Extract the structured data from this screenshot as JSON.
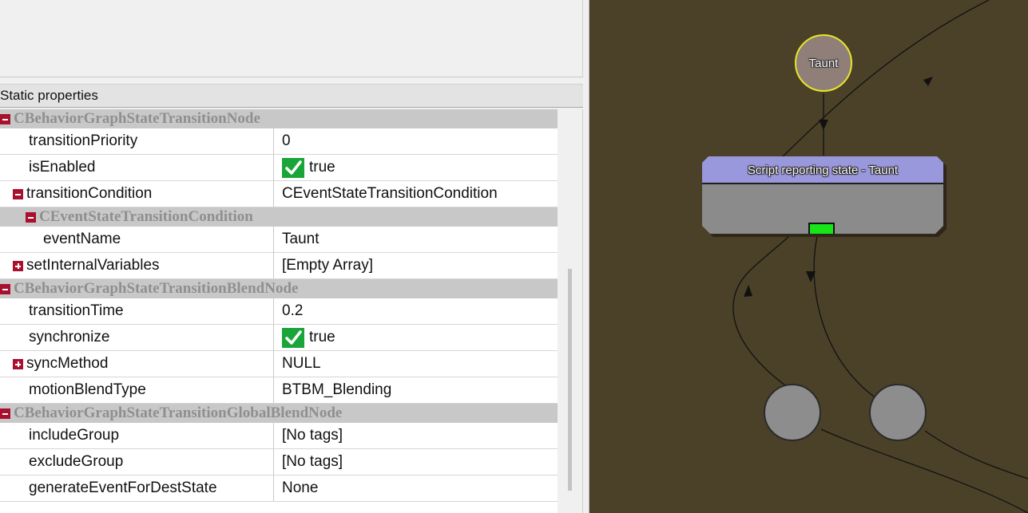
{
  "properties_panel": {
    "header": "Static properties",
    "rows": [
      {
        "kind": "category",
        "label": "CBehaviorGraphStateTransitionNode",
        "toggle": "minus",
        "indent": 0
      },
      {
        "kind": "prop",
        "name": "transitionPriority",
        "value": "0"
      },
      {
        "kind": "prop",
        "name": "isEnabled",
        "value": "true",
        "checkbox": true
      },
      {
        "kind": "prop",
        "name": "transitionCondition",
        "value": "CEventStateTransitionCondition",
        "toggle": "minus"
      },
      {
        "kind": "category",
        "label": "CEventStateTransitionCondition",
        "toggle": "minus",
        "indent": 1
      },
      {
        "kind": "prop",
        "name": "eventName",
        "value": "Taunt",
        "indent": 1
      },
      {
        "kind": "prop",
        "name": "setInternalVariables",
        "value": "[Empty Array]",
        "toggle": "plus"
      },
      {
        "kind": "category",
        "label": "CBehaviorGraphStateTransitionBlendNode",
        "toggle": "minus",
        "indent": 0
      },
      {
        "kind": "prop",
        "name": "transitionTime",
        "value": "0.2"
      },
      {
        "kind": "prop",
        "name": "synchronize",
        "value": "true",
        "checkbox": true
      },
      {
        "kind": "prop",
        "name": "syncMethod",
        "value": "NULL",
        "toggle": "plus"
      },
      {
        "kind": "prop",
        "name": "motionBlendType",
        "value": "BTBM_Blending"
      },
      {
        "kind": "category",
        "label": "CBehaviorGraphStateTransitionGlobalBlendNode",
        "toggle": "minus",
        "indent": 0
      },
      {
        "kind": "prop",
        "name": "includeGroup",
        "value": "[No tags]"
      },
      {
        "kind": "prop",
        "name": "excludeGroup",
        "value": "[No tags]"
      },
      {
        "kind": "prop",
        "name": "generateEventForDestState",
        "value": "None"
      }
    ]
  },
  "graph": {
    "taunt_node_label": "Taunt",
    "state_node_title": "Script reporting state - Taunt",
    "colors": {
      "canvas_bg": "#4b4129",
      "state_header": "#9a98dc",
      "state_body": "#8b8b8b",
      "active_indicator": "#17e517",
      "taunt_border": "#e6e62b"
    }
  }
}
